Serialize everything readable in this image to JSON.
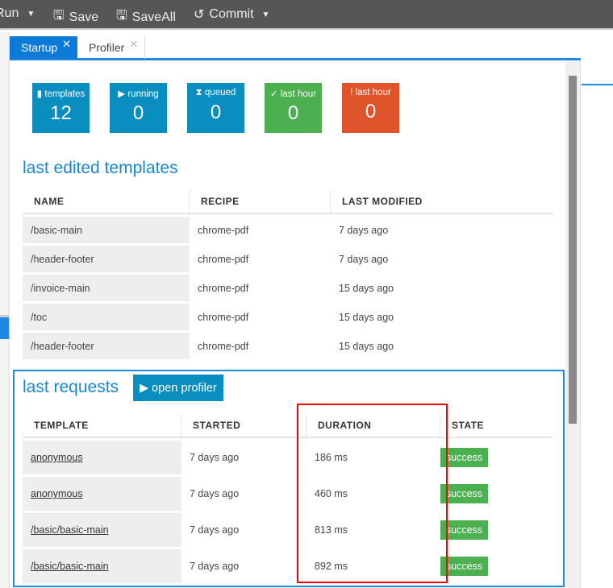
{
  "toolbar": {
    "run": "Run",
    "save": "Save",
    "saveall": "SaveAll",
    "commit": "Commit"
  },
  "tabs": [
    {
      "label": "Startup",
      "active": true
    },
    {
      "label": "Profiler",
      "active": false
    }
  ],
  "tiles": [
    {
      "icon": "file-icon",
      "glyph": "▮",
      "label": "templates",
      "value": "12",
      "color": "#0a8ec0"
    },
    {
      "icon": "play-icon",
      "glyph": "▶",
      "label": "running",
      "value": "0",
      "color": "#0a8ec0"
    },
    {
      "icon": "hourglass-icon",
      "glyph": "⧗",
      "label": "queued",
      "value": "0",
      "color": "#0a8ec0"
    },
    {
      "icon": "check-icon",
      "glyph": "✓",
      "label": "last hour",
      "value": "0",
      "color": "#4caf50"
    },
    {
      "icon": "exclamation-icon",
      "glyph": "!",
      "label": "last hour",
      "value": "0",
      "color": "#e0542c"
    }
  ],
  "templates": {
    "title": "last edited templates",
    "columns": [
      "NAME",
      "RECIPE",
      "LAST MODIFIED"
    ],
    "rows": [
      [
        "/basic-main",
        "chrome-pdf",
        "7 days ago"
      ],
      [
        "/header-footer",
        "chrome-pdf",
        "7 days ago"
      ],
      [
        "/invoice-main",
        "chrome-pdf",
        "15 days ago"
      ],
      [
        "/toc",
        "chrome-pdf",
        "15 days ago"
      ],
      [
        "/header-footer",
        "chrome-pdf",
        "15 days ago"
      ]
    ]
  },
  "requests": {
    "title": "last requests",
    "open_profiler": "open profiler",
    "columns": [
      "TEMPLATE",
      "STARTED",
      "DURATION",
      "STATE"
    ],
    "rows": [
      [
        "anonymous",
        "7 days ago",
        "186 ms",
        "success"
      ],
      [
        "anonymous",
        "7 days ago",
        "460 ms",
        "success"
      ],
      [
        "/basic/basic-main",
        "7 days ago",
        "813 ms",
        "success"
      ],
      [
        "/basic/basic-main",
        "7 days ago",
        "892 ms",
        "success"
      ]
    ]
  }
}
